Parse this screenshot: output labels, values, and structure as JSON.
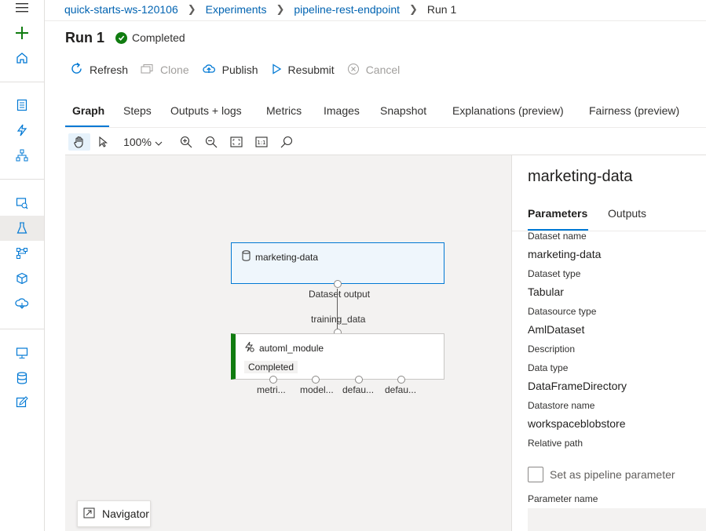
{
  "breadcrumb": {
    "items": [
      "quick-starts-ws-120106",
      "Experiments",
      "pipeline-rest-endpoint"
    ],
    "current": "Run 1"
  },
  "run": {
    "title": "Run 1",
    "status": "Completed"
  },
  "toolbar": {
    "refresh": "Refresh",
    "clone": "Clone",
    "publish": "Publish",
    "resubmit": "Resubmit",
    "cancel": "Cancel"
  },
  "tabs": [
    "Graph",
    "Steps",
    "Outputs + logs",
    "Metrics",
    "Images",
    "Snapshot",
    "Explanations (preview)",
    "Fairness (preview)"
  ],
  "graph_toolbar": {
    "zoom": "100%"
  },
  "graph": {
    "node1": {
      "title": "marketing-data",
      "output_label": "Dataset output"
    },
    "edge_label": "training_data",
    "node2": {
      "title": "automl_module",
      "status": "Completed",
      "ports": [
        "metri...",
        "model...",
        "defau...",
        "defau..."
      ]
    },
    "navigator": "Navigator"
  },
  "panel": {
    "title": "marketing-data",
    "tabs": [
      "Parameters",
      "Outputs"
    ],
    "fields": [
      {
        "label": "Dataset name",
        "value": "marketing-data"
      },
      {
        "label": "Dataset type",
        "value": "Tabular"
      },
      {
        "label": "Datasource type",
        "value": "AmlDataset"
      },
      {
        "label": "Description",
        "value": ""
      },
      {
        "label": "Data type",
        "value": "DataFrameDirectory"
      },
      {
        "label": "Datastore name",
        "value": "workspaceblobstore"
      },
      {
        "label": "Relative path",
        "value": ""
      }
    ],
    "checkbox_label": "Set as pipeline parameter",
    "param_name_label": "Parameter name"
  },
  "colors": {
    "accent": "#0078d4",
    "success": "#107c10",
    "link": "#0063b1"
  }
}
